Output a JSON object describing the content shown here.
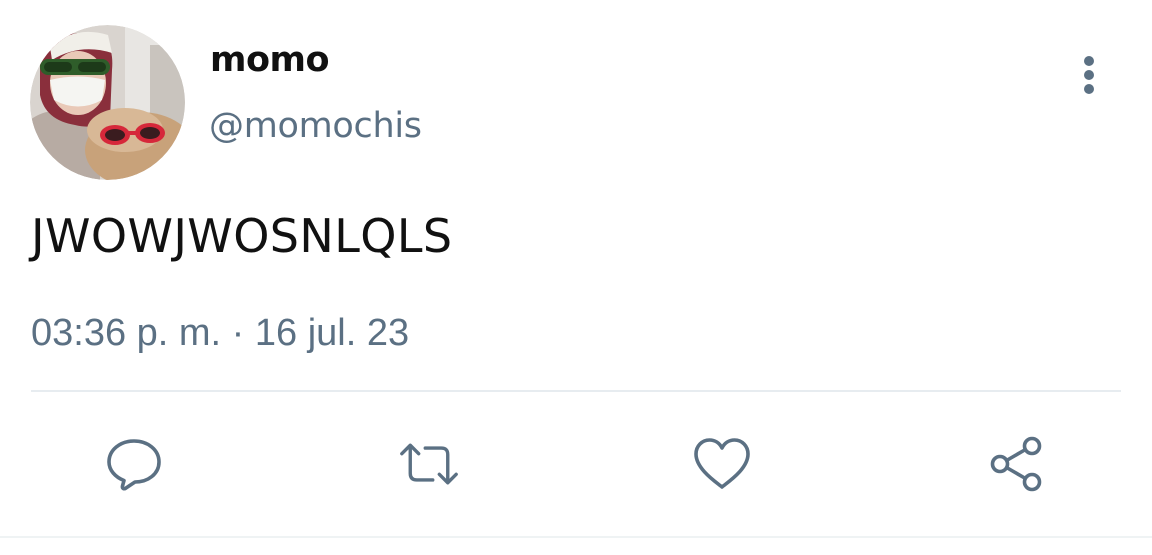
{
  "user": {
    "display_name": "momo",
    "handle": "@momochis"
  },
  "tweet": {
    "text": "JWOWJWOSNLQLS",
    "timestamp": "03:36 p. m. · 16 jul. 23"
  },
  "actions": [
    {
      "name": "reply",
      "icon": "reply-icon"
    },
    {
      "name": "retweet",
      "icon": "retweet-icon"
    },
    {
      "name": "like",
      "icon": "heart-icon"
    },
    {
      "name": "share",
      "icon": "share-icon"
    }
  ],
  "colors": {
    "text_primary": "#111111",
    "text_secondary": "#5b7083",
    "icon": "#5b7083",
    "divider": "#e7ecf0"
  }
}
